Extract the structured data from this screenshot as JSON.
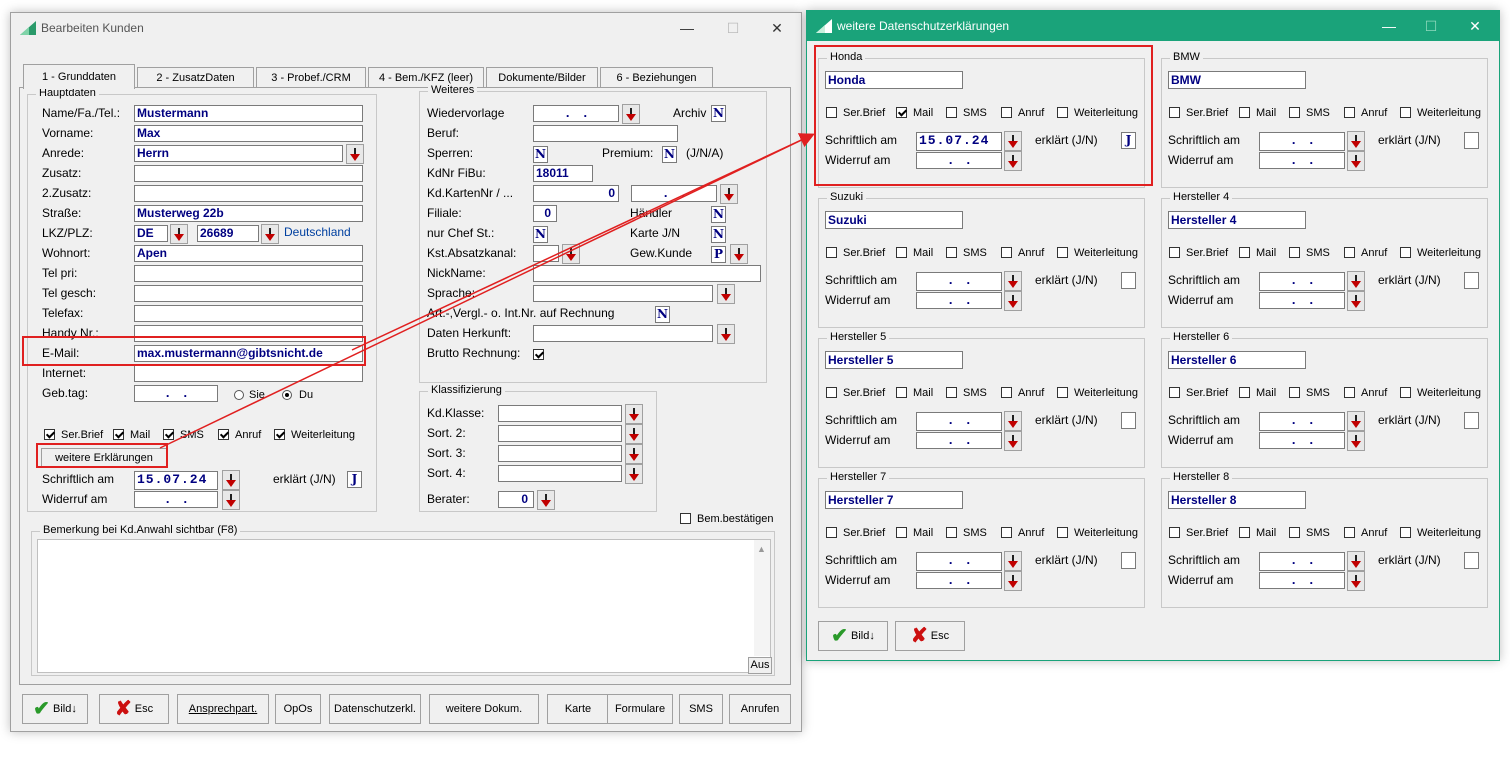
{
  "main_window": {
    "title": "Bearbeiten Kunden",
    "tabs": [
      {
        "label": "1 - Grunddaten"
      },
      {
        "label": "2 - ZusatzDaten"
      },
      {
        "label": "3 - Probef./CRM"
      },
      {
        "label": "4 - Bem./KFZ (leer)"
      },
      {
        "label": "Dokumente/Bilder"
      },
      {
        "label": "6 - Beziehungen"
      }
    ],
    "hauptdaten": {
      "group_label": "Hauptdaten",
      "name_label": "Name/Fa./Tel.:",
      "name_value": "Mustermann",
      "vorname_label": "Vorname:",
      "vorname_value": "Max",
      "anrede_label": "Anrede:",
      "anrede_value": "Herrn",
      "zusatz_label": "Zusatz:",
      "zusatz_value": "",
      "zusatz2_label": "2.Zusatz:",
      "zusatz2_value": "",
      "strasse_label": "Straße:",
      "strasse_value": "Musterweg 22b",
      "lkz_label": "LKZ/PLZ:",
      "lkz_value": "DE",
      "plz_value": "26689",
      "land_value": "Deutschland",
      "wohnort_label": "Wohnort:",
      "wohnort_value": "Apen",
      "telpri_label": "Tel pri:",
      "telgesch_label": "Tel gesch:",
      "telefax_label": "Telefax:",
      "handy_label": "Handy Nr.:",
      "email_label": "E-Mail:",
      "email_value": "max.mustermann@gibtsnicht.de",
      "internet_label": "Internet:",
      "gebtag_label": "Geb.tag:",
      "gebtag_value": ".   .",
      "sie_label": "Sie",
      "du_label": "Du",
      "consent": [
        "Ser.Brief",
        "Mail",
        "SMS",
        "Anruf",
        "Weiterleitung"
      ],
      "weitere_button": "weitere Erklärungen",
      "schriftlich_label": "Schriftlich am",
      "schriftlich_value": "15.07.24",
      "erklaert_label": "erklärt (J/N)",
      "erklaert_value": "J",
      "widerruf_label": "Widerruf am",
      "widerruf_value": ".   ."
    },
    "weiteres": {
      "group_label": "Weiteres",
      "wiedervorlage_label": "Wiedervorlage",
      "wiedervorlage_value": ".   .",
      "archiv_label": "Archiv",
      "archiv_value": "N",
      "beruf_label": "Beruf:",
      "sperren_label": "Sperren:",
      "sperren_value": "N",
      "premium_label": "Premium:",
      "premium_value": "N",
      "premium_hint": "(J/N/A)",
      "kdnr_label": "KdNr FiBu:",
      "kdnr_value": "18011",
      "karten_label": "Kd.KartenNr / ...",
      "karten_value": "0",
      "karten_date": ".   .",
      "filiale_label": "Filiale:",
      "filiale_value": "0",
      "haendler_label": "Händler",
      "haendler_value": "N",
      "chef_label": "nur Chef St.:",
      "chef_value": "N",
      "karte_label": "Karte J/N",
      "karte_value": "N",
      "kst_label": "Kst.Absatzkanal:",
      "gewkunde_label": "Gew.Kunde",
      "gewkunde_value": "P",
      "nickname_label": "NickName:",
      "sprache_label": "Sprache:",
      "art_label": "Art.-,Vergl.- o. Int.Nr. auf Rechnung",
      "art_value": "N",
      "herkunft_label": "Daten Herkunft:",
      "brutto_label": "Brutto Rechnung:"
    },
    "klassifizierung": {
      "group_label": "Klassifizierung",
      "kdklasse_label": "Kd.Klasse:",
      "sort2_label": "Sort. 2:",
      "sort3_label": "Sort. 3:",
      "sort4_label": "Sort. 4:",
      "berater_label": "Berater:",
      "berater_value": "0"
    },
    "bem_bestaetigen_label": "Bem.bestätigen",
    "bemerkung_label": "Bemerkung bei Kd.Anwahl sichtbar (F8)",
    "aus_label": "Aus",
    "buttons": [
      "Bild",
      "Esc",
      "Ansprechpart.",
      "OpOs",
      "Datenschutzerkl.",
      "weitere Dokum.",
      "Karte",
      "Formulare",
      "SMS",
      "Anrufen"
    ]
  },
  "dialog": {
    "title": "weitere Datenschutzerklärungen",
    "consent_labels": [
      "Ser.Brief",
      "Mail",
      "SMS",
      "Anruf",
      "Weiterleitung"
    ],
    "schriftlich_label": "Schriftlich am",
    "widerruf_label": "Widerruf am",
    "erklaert_label": "erklärt (J/N)",
    "manufacturers": [
      {
        "group": "Honda",
        "name": "Honda",
        "schriftlich": "15.07.24",
        "widerruf": ".   .",
        "erklaert": "J",
        "checked": [
          false,
          true,
          false,
          false,
          false
        ]
      },
      {
        "group": "BMW",
        "name": "BMW",
        "schriftlich": ".   .",
        "widerruf": ".   .",
        "erklaert": "",
        "checked": [
          false,
          false,
          false,
          false,
          false
        ]
      },
      {
        "group": "Suzuki",
        "name": "Suzuki",
        "schriftlich": ".   .",
        "widerruf": ".   .",
        "erklaert": "",
        "checked": [
          false,
          false,
          false,
          false,
          false
        ]
      },
      {
        "group": "Hersteller 4",
        "name": "Hersteller 4",
        "schriftlich": ".   .",
        "widerruf": ".   .",
        "erklaert": "",
        "checked": [
          false,
          false,
          false,
          false,
          false
        ]
      },
      {
        "group": "Hersteller 5",
        "name": "Hersteller 5",
        "schriftlich": ".   .",
        "widerruf": ".   .",
        "erklaert": "",
        "checked": [
          false,
          false,
          false,
          false,
          false
        ]
      },
      {
        "group": "Hersteller 6",
        "name": "Hersteller 6",
        "schriftlich": ".   .",
        "widerruf": ".   .",
        "erklaert": "",
        "checked": [
          false,
          false,
          false,
          false,
          false
        ]
      },
      {
        "group": "Hersteller 7",
        "name": "Hersteller 7",
        "schriftlich": ".   .",
        "widerruf": ".   .",
        "erklaert": "",
        "checked": [
          false,
          false,
          false,
          false,
          false
        ]
      },
      {
        "group": "Hersteller 8",
        "name": "Hersteller 8",
        "schriftlich": ".   .",
        "widerruf": ".   .",
        "erklaert": "",
        "checked": [
          false,
          false,
          false,
          false,
          false
        ]
      }
    ],
    "buttons": [
      "Bild",
      "Esc"
    ]
  },
  "colors": {
    "accent_green": "#1aa37a",
    "highlight_red": "#e02020",
    "field_text": "#000080"
  }
}
